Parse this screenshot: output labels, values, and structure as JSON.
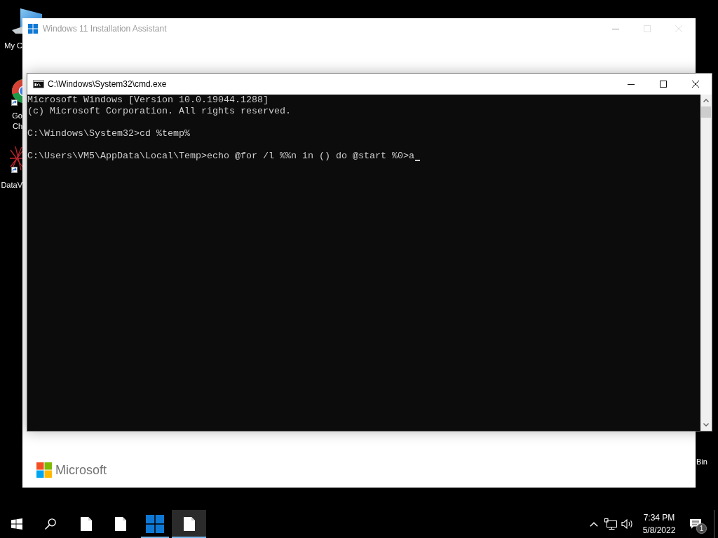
{
  "desktop": {
    "icons": [
      {
        "label_lines": [
          "My C"
        ],
        "kind": "computer",
        "shortcut": false
      },
      {
        "label_lines": [
          "Go",
          "Ch"
        ],
        "kind": "browser",
        "shortcut": true
      },
      {
        "label_lines": [
          "DataV"
        ],
        "kind": "app",
        "shortcut": true
      },
      {
        "label_lines": [
          "Bin"
        ],
        "kind": "covered",
        "shortcut": false
      }
    ]
  },
  "installer_window": {
    "title": "Windows 11 Installation Assistant",
    "active": false,
    "controls": [
      {
        "kind": "minimize",
        "disabled": false
      },
      {
        "kind": "maximize",
        "disabled": true
      },
      {
        "kind": "close",
        "disabled": true
      }
    ],
    "brand": "Microsoft"
  },
  "console_window": {
    "title": "C:\\Windows\\System32\\cmd.exe",
    "active": true,
    "controls": [
      {
        "kind": "minimize",
        "disabled": false
      },
      {
        "kind": "maximize",
        "disabled": false
      },
      {
        "kind": "close",
        "disabled": false
      }
    ],
    "output_blocks": [
      [
        "Microsoft Windows [Version 10.0.19044.1288]",
        "(c) Microsoft Corporation. All rights reserved."
      ],
      [
        "C:\\Windows\\System32>cd %temp%"
      ],
      [
        "C:\\Users\\VM5\\AppData\\Local\\Temp>echo @for /l %%n in () do @start %0>a"
      ]
    ],
    "cursor_visible": true
  },
  "taskbar": {
    "apps": [
      {
        "kind": "file",
        "running": false,
        "selected": false
      },
      {
        "kind": "file",
        "running": false,
        "selected": false
      },
      {
        "kind": "windows",
        "running": true,
        "selected": false
      },
      {
        "kind": "file",
        "running": true,
        "selected": true
      }
    ],
    "clock": {
      "time": "7:34 PM",
      "date": "5/8/2022"
    },
    "notification_count": "1"
  }
}
